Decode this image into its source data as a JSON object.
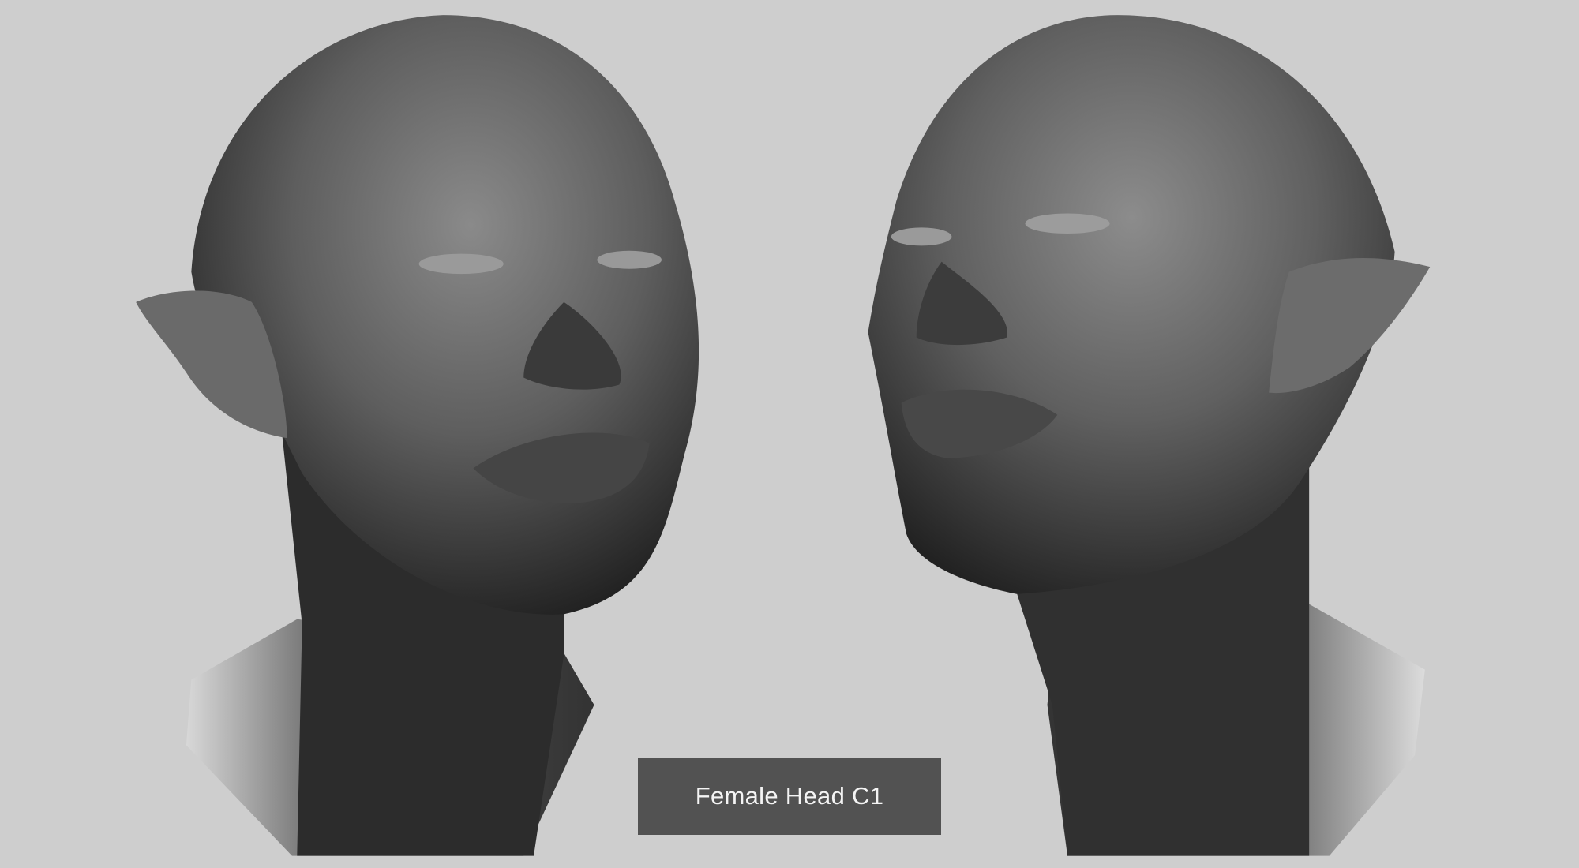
{
  "caption": {
    "title": "Female Head C1"
  },
  "colors": {
    "background": "#cecece",
    "caption_box": "#525252",
    "caption_text": "#f4f4f4"
  },
  "render": {
    "subject_left": "sculpted-head-three-quarter-left",
    "subject_right": "sculpted-head-three-quarter-right"
  }
}
